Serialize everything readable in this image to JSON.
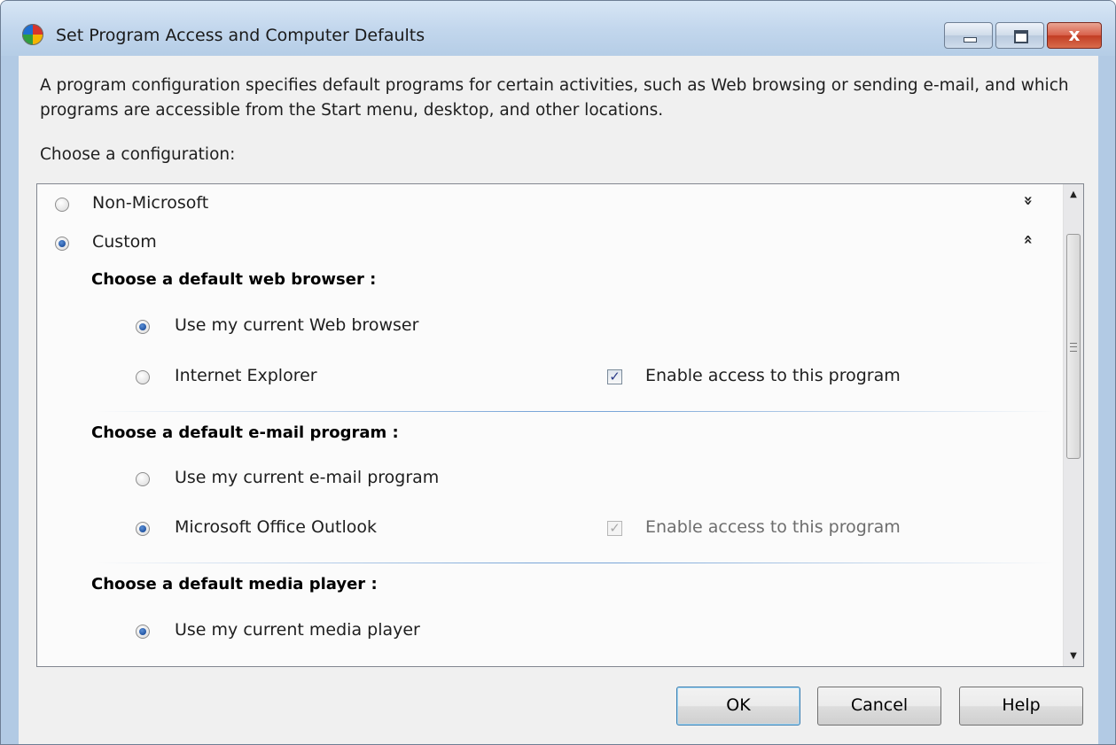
{
  "window": {
    "title": "Set Program Access and Computer Defaults",
    "close_glyph": "x"
  },
  "description": "A program configuration specifies default programs for certain activities, such as Web browsing or sending e-mail, and which programs are accessible from the Start menu, desktop, and other locations.",
  "choose_label": "Choose a configuration:",
  "configurations": [
    {
      "label": "Non-Microsoft",
      "selected": false,
      "expand_icon": "chevron-double-down"
    },
    {
      "label": "Custom",
      "selected": true,
      "expand_icon": "chevron-double-up"
    }
  ],
  "sections": {
    "browser": {
      "heading": "Choose a default web browser :",
      "options": [
        {
          "label": "Use my current Web browser",
          "selected": true
        },
        {
          "label": "Internet Explorer",
          "selected": false
        }
      ],
      "access_label": "Enable access to this program",
      "access_checked": true,
      "access_enabled": true
    },
    "email": {
      "heading": "Choose a default e-mail program :",
      "options": [
        {
          "label": "Use my current e-mail program",
          "selected": false
        },
        {
          "label": "Microsoft Office Outlook",
          "selected": true
        }
      ],
      "access_label": "Enable access to this program",
      "access_checked": true,
      "access_enabled": false
    },
    "media": {
      "heading": "Choose a default media player :",
      "options": [
        {
          "label": "Use my current media player",
          "selected": true
        }
      ]
    }
  },
  "chevrons": {
    "down": "»",
    "up": "«"
  },
  "checkmark": "✓",
  "scroll": {
    "up_arrow": "▲",
    "down_arrow": "▼"
  },
  "buttons": {
    "ok": "OK",
    "cancel": "Cancel",
    "help": "Help"
  }
}
